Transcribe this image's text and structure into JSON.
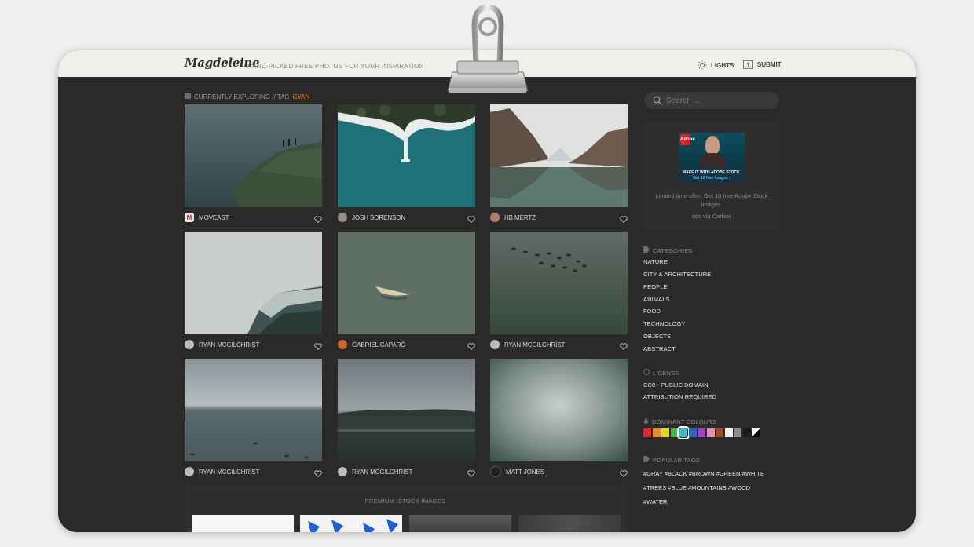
{
  "header": {
    "logo": "Magdeleine",
    "tagline": "HAND-PICKED FREE PHOTOS FOR YOUR INSPIRATION",
    "nav": [
      {
        "label": "LIGHTS",
        "icon": "sun-icon"
      },
      {
        "label": "SUBMIT",
        "icon": "upload-icon"
      }
    ]
  },
  "breadcrumb": {
    "prefix": "CURRENTLY EXPLORING // TAG",
    "tag": "CYAN"
  },
  "photos": [
    {
      "author": "MOVEAST",
      "avatar": "moveast-logo"
    },
    {
      "author": "JOSH SORENSON",
      "avatar": "user-avatar"
    },
    {
      "author": "HB MERTZ",
      "avatar": "user-avatar"
    },
    {
      "author": "RYAN MCGILCHRIST",
      "avatar": "user-avatar"
    },
    {
      "author": "GABRIEL CAPARÓ",
      "avatar": "user-avatar"
    },
    {
      "author": "RYAN MCGILCHRIST",
      "avatar": "user-avatar"
    },
    {
      "author": "RYAN MCGILCHRIST",
      "avatar": "user-avatar"
    },
    {
      "author": "RYAN MCGILCHRIST",
      "avatar": "user-avatar"
    },
    {
      "author": "MATT JONES",
      "avatar": "user-avatar"
    }
  ],
  "search": {
    "placeholder": "Search ..."
  },
  "ad": {
    "brand": "Adobe",
    "headline": "MAKE IT WITH ADOBE STOCK.",
    "cta": "Get 10 free images ›",
    "text": "Limited time offer: Get 10 free Adobe Stock images.",
    "via": "ads via Carbon"
  },
  "sidebar": {
    "categories_title": "CATEGORIES",
    "categories": [
      "NATURE",
      "CITY & ARCHITECTURE",
      "PEOPLE",
      "ANIMALS",
      "FOOD",
      "TECHNOLOGY",
      "OBJECTS",
      "ABSTRACT"
    ],
    "license_title": "LICENSE",
    "licenses": [
      "CC0 - PUBLIC DOMAIN",
      "ATTRIBUTION REQUIRED"
    ],
    "colours_title": "DOMINANT COLOURS",
    "colours": [
      "#e02a2a",
      "#ef8c1f",
      "#e9d51d",
      "#41b64a",
      "#3fb8c8",
      "#2c63c5",
      "#a43fc2",
      "#e78fb3",
      "#9c4a2a",
      "#f1f1f1",
      "#8c8c8c",
      "#1a1a1a",
      "#ffffff"
    ],
    "selected_colour": "#3fb8c8",
    "tags_title": "POPULAR TAGS",
    "tags": [
      "#GRAY",
      "#BLACK",
      "#BROWN",
      "#GREEN",
      "#WHITE",
      "#TREES",
      "#BLUE",
      "#MOUNTAINS",
      "#WOOD",
      "#WATER"
    ]
  },
  "premium": {
    "title": "PREMIUM ISTOCK IMAGES"
  }
}
